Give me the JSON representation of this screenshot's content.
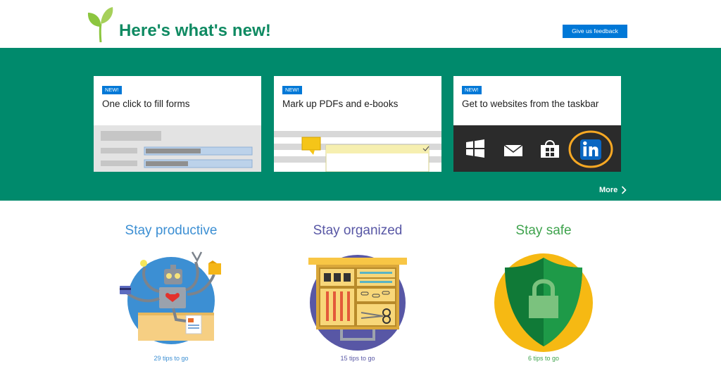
{
  "header": {
    "title": "Here's what's new!",
    "feedback_label": "Give us feedback"
  },
  "cards": [
    {
      "badge": "NEW!",
      "title": "One click to fill forms"
    },
    {
      "badge": "NEW!",
      "title": "Mark up PDFs and e-books"
    },
    {
      "badge": "NEW!",
      "title": "Get to websites from the taskbar"
    }
  ],
  "more_label": "More",
  "categories": [
    {
      "title": "Stay productive",
      "tips": "29 tips to go",
      "color": "#3c8fd3"
    },
    {
      "title": "Stay organized",
      "tips": "15 tips to go",
      "color": "#5857a5"
    },
    {
      "title": "Stay safe",
      "tips": "6 tips to go",
      "color": "#3fa34d"
    }
  ],
  "colors": {
    "brand_green": "#008a6c",
    "title_green": "#0f8a62",
    "accent_blue": "#0078d7"
  }
}
